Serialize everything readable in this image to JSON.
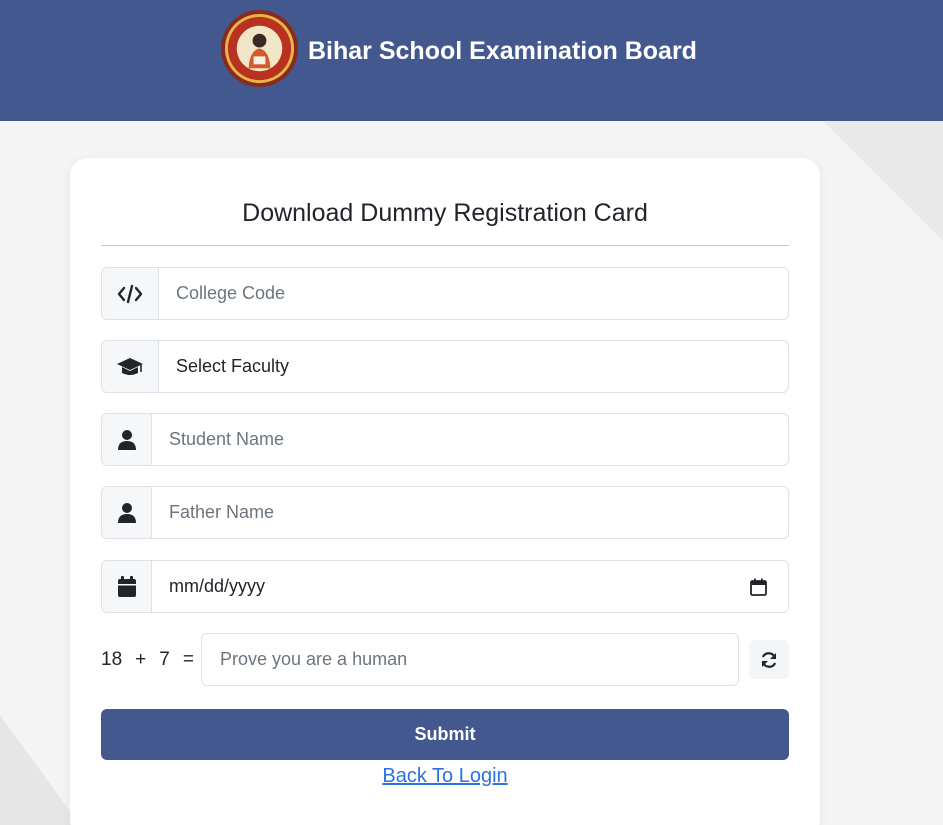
{
  "header": {
    "title": "Bihar School Examination Board",
    "logo_icon": "bseb-emblem-icon",
    "background": "#42588f"
  },
  "form": {
    "title": "Download Dummy Registration Card",
    "fields": [
      {
        "icon": "code-icon",
        "placeholder": "College Code",
        "value": ""
      },
      {
        "icon": "graduation-cap-icon",
        "placeholder": "",
        "value": "Select Faculty"
      },
      {
        "icon": "user-icon",
        "placeholder": "Student Name",
        "value": ""
      },
      {
        "icon": "user-icon",
        "placeholder": "Father Name",
        "value": ""
      },
      {
        "icon": "calendar-icon",
        "placeholder": "",
        "value": "mm/dd/yyyy"
      }
    ],
    "captcha": {
      "a": "18",
      "op": "+",
      "b": "7",
      "eq": "=",
      "placeholder": "Prove you are a human",
      "refresh_icon": "refresh-icon"
    },
    "submit_label": "Submit",
    "back_link": "Back To Login",
    "accent": "#42588f",
    "link_color": "#2b72e0"
  }
}
